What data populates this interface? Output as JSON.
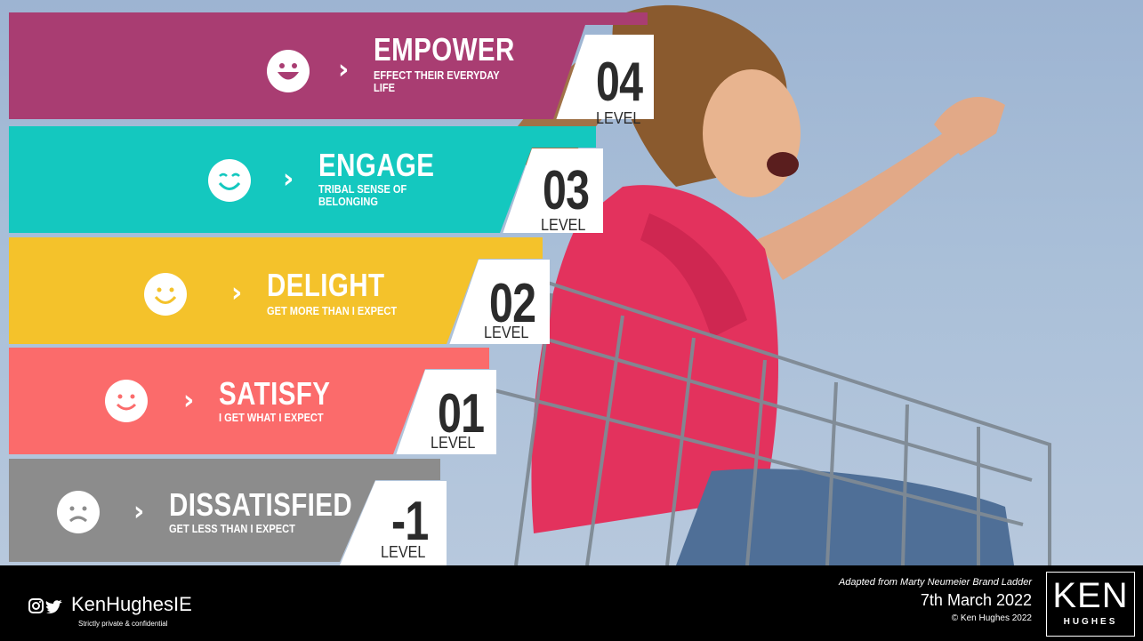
{
  "levels": [
    {
      "title": "EMPOWER",
      "subtitle_line1": "EFFECT THEIR EVERYDAY",
      "subtitle_line2": "LIFE",
      "number": "04",
      "level_label": "LEVEL",
      "face": "very-happy",
      "color": "#a93d72"
    },
    {
      "title": "ENGAGE",
      "subtitle_line1": "TRIBAL SENSE OF",
      "subtitle_line2": "BELONGING",
      "number": "03",
      "level_label": "LEVEL",
      "face": "content",
      "color": "#14c8bf"
    },
    {
      "title": "DELIGHT",
      "subtitle_line1": "GET MORE THAN I EXPECT",
      "subtitle_line2": "",
      "number": "02",
      "level_label": "LEVEL",
      "face": "smile",
      "color": "#f4c22b"
    },
    {
      "title": "SATISFY",
      "subtitle_line1": "I GET WHAT I EXPECT",
      "subtitle_line2": "",
      "number": "01",
      "level_label": "LEVEL",
      "face": "smile",
      "color": "#fb6b6b"
    },
    {
      "title": "DISSATISFIED",
      "subtitle_line1": "GET LESS THAN I EXPECT",
      "subtitle_line2": "",
      "number": "-1",
      "level_label": "LEVEL",
      "face": "sad",
      "color": "#8c8c8c"
    }
  ],
  "chevron": "›",
  "footer": {
    "handle": "KenHughesIE",
    "confidential": "Strictly private & confidential",
    "adapted": "Adapted from Marty Neumeier Brand Ladder",
    "date": "7th March 2022",
    "copyright": "© Ken Hughes 2022",
    "social_icons": [
      "instagram-icon",
      "twitter-icon"
    ]
  },
  "logo": {
    "name": "KEN",
    "surname": "HUGHES"
  }
}
